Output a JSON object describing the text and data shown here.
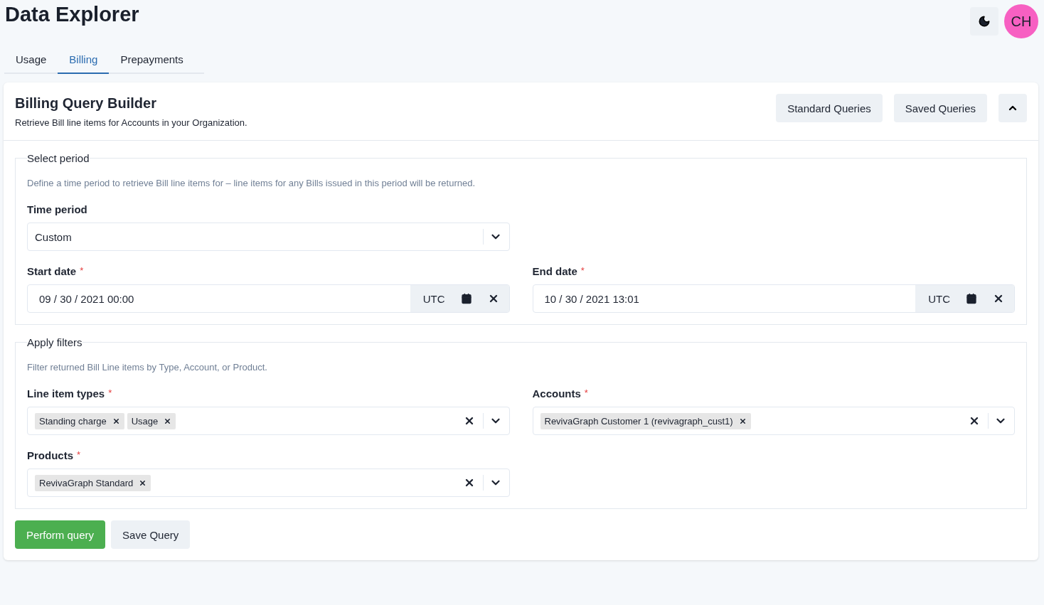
{
  "header": {
    "title": "Data Explorer",
    "avatar": "CH"
  },
  "tabs": [
    {
      "label": "Usage",
      "selected": false
    },
    {
      "label": "Billing",
      "selected": true
    },
    {
      "label": "Prepayments",
      "selected": false
    }
  ],
  "card": {
    "title": "Billing Query Builder",
    "subtitle": "Retrieve Bill line items for Accounts in your Organization.",
    "buttons": [
      "Standard Queries",
      "Saved Queries"
    ],
    "expanded": true
  },
  "sections": [
    {
      "legend": "Select period",
      "description": "Define a time period to retrieve Bill line items for – line items for any Bills issued in this period will be returned.",
      "fields": [
        {
          "kind": "select",
          "label": "Time period",
          "value": "Custom"
        },
        {
          "kind": "date",
          "label": "Start date",
          "required_mark": "*",
          "value": "09 / 30 / 2021 00:00",
          "zone": "UTC"
        },
        {
          "kind": "date",
          "label": "End date",
          "required_mark": "*",
          "value": "10 / 30 / 2021 13:01",
          "zone": "UTC"
        }
      ]
    },
    {
      "legend": "Apply filters",
      "description": "Filter returned Bill Line items by Type, Account, or Product.",
      "fields": [
        {
          "kind": "multi",
          "label": "Line item types",
          "required_mark": "*",
          "chips": [
            "Standing charge",
            "Usage"
          ]
        },
        {
          "kind": "multi",
          "label": "Accounts",
          "required_mark": "*",
          "chips": [
            "RevivaGraph Customer 1 (revivagraph_cust1)"
          ]
        },
        {
          "kind": "multi",
          "label": "Products",
          "required_mark": "*",
          "chips": [
            "RevivaGraph Standard"
          ]
        }
      ]
    }
  ],
  "actions": [
    {
      "label": "Perform query",
      "kind": "primary"
    },
    {
      "label": "Save Query",
      "kind": "secondary"
    }
  ]
}
